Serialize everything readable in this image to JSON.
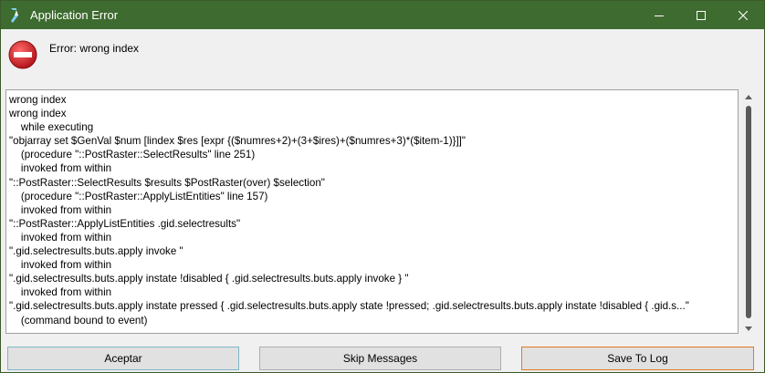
{
  "window": {
    "title": "Application Error"
  },
  "header": {
    "message": "Error: wrong index"
  },
  "log": {
    "lines": [
      "wrong index",
      "wrong index",
      "    while executing",
      "\"objarray set $GenVal $num [lindex $res [expr {($numres+2)+(3+$ires)+($numres+3)*($item-1)}]]\"",
      "    (procedure \"::PostRaster::SelectResults\" line 251)",
      "    invoked from within",
      "\"::PostRaster::SelectResults $results $PostRaster(over) $selection\"",
      "    (procedure \"::PostRaster::ApplyListEntities\" line 157)",
      "    invoked from within",
      "\"::PostRaster::ApplyListEntities .gid.selectresults\"",
      "    invoked from within",
      "\".gid.selectresults.buts.apply invoke \"",
      "    invoked from within",
      "\".gid.selectresults.buts.apply instate !disabled { .gid.selectresults.buts.apply invoke } \"",
      "    invoked from within",
      "\".gid.selectresults.buts.apply instate pressed { .gid.selectresults.buts.apply state !pressed; .gid.selectresults.buts.apply instate !disabled { .gid.s...\"",
      "    (command bound to event)"
    ]
  },
  "buttons": {
    "accept": "Aceptar",
    "skip": "Skip Messages",
    "save": "Save To Log"
  },
  "colors": {
    "titlebar": "#3e6b2f",
    "accept_border": "#7fb6c6",
    "save_border": "#e07b1f",
    "error_icon": "#d0262a"
  }
}
